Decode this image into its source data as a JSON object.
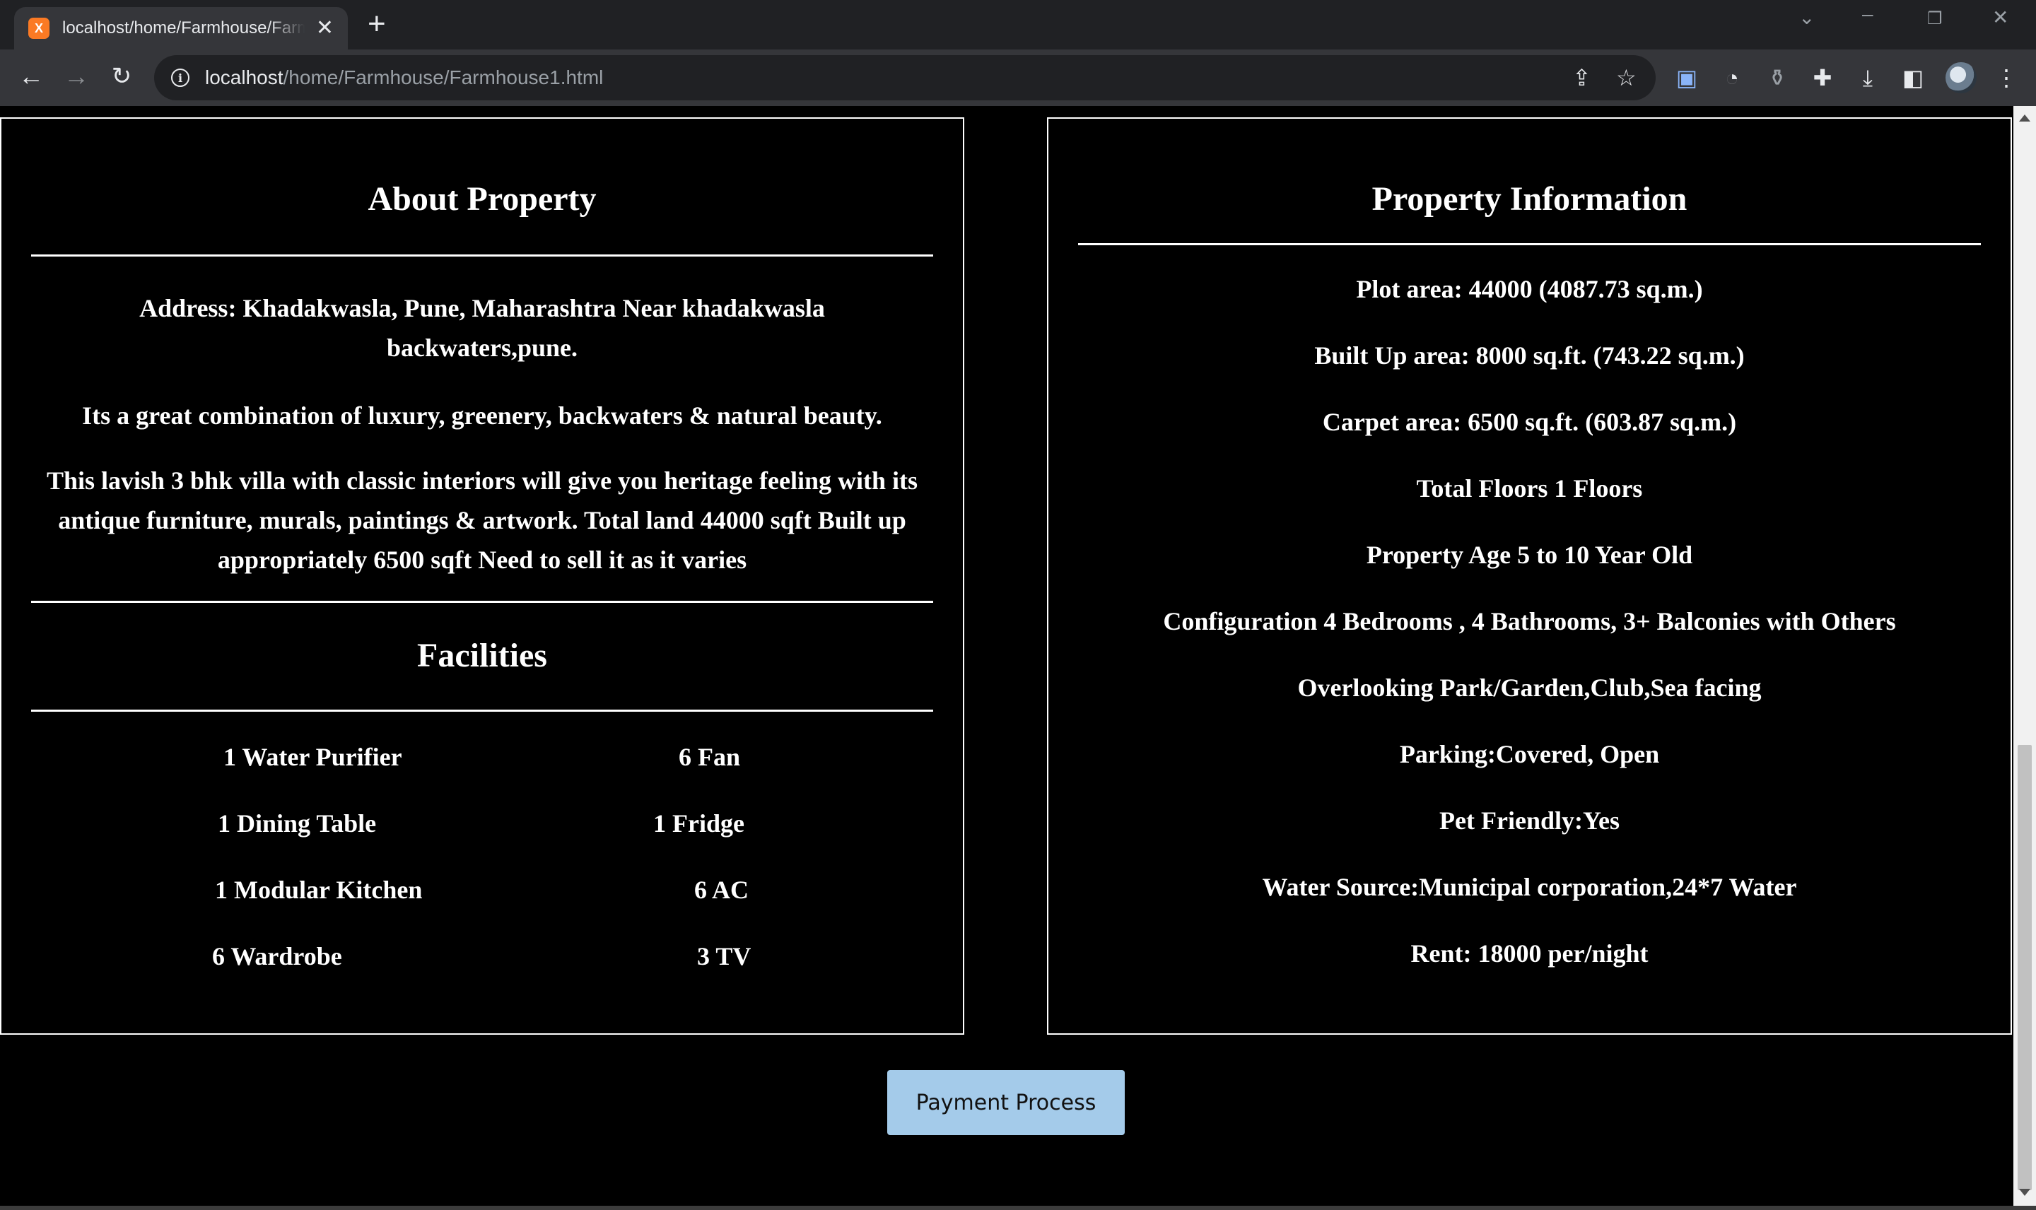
{
  "browser": {
    "tab_title": "localhost/home/Farmhouse/Farmhouse1.html",
    "favicon_label": "X",
    "url_host": "localhost",
    "url_path": "/home/Farmhouse/Farmhouse1.html"
  },
  "about": {
    "heading": "About Property",
    "paragraphs": [
      "Address: Khadakwasla, Pune, Maharashtra Near khadakwasla backwaters,pune.",
      "Its a great combination of luxury, greenery, backwaters & natural beauty.",
      "This lavish 3 bhk villa with classic interiors will give you heritage feeling with its antique furniture, murals, paintings & artwork. Total land 44000 sqft Built up appropriately 6500 sqft Need to sell it as it varies"
    ]
  },
  "facilities": {
    "heading": "Facilities",
    "items": [
      "1 Water Purifier",
      "6 Fan",
      "1 Dining Table",
      "1 Fridge",
      "1 Modular Kitchen",
      "6 AC",
      "6 Wardrobe",
      "3 TV"
    ]
  },
  "property_info": {
    "heading": "Property Information",
    "lines": [
      "Plot area: 44000 (4087.73 sq.m.)",
      "Built Up area: 8000 sq.ft. (743.22 sq.m.)",
      "Carpet area: 6500 sq.ft. (603.87 sq.m.)",
      "Total Floors 1 Floors",
      "Property Age 5 to 10 Year Old",
      "Configuration 4 Bedrooms , 4 Bathrooms, 3+ Balconies with Others",
      "Overlooking Park/Garden,Club,Sea facing",
      "Parking:Covered, Open",
      "Pet Friendly:Yes",
      "Water Source:Municipal corporation,24*7 Water",
      "Rent: 18000 per/night"
    ]
  },
  "payment_button": "Payment Process"
}
